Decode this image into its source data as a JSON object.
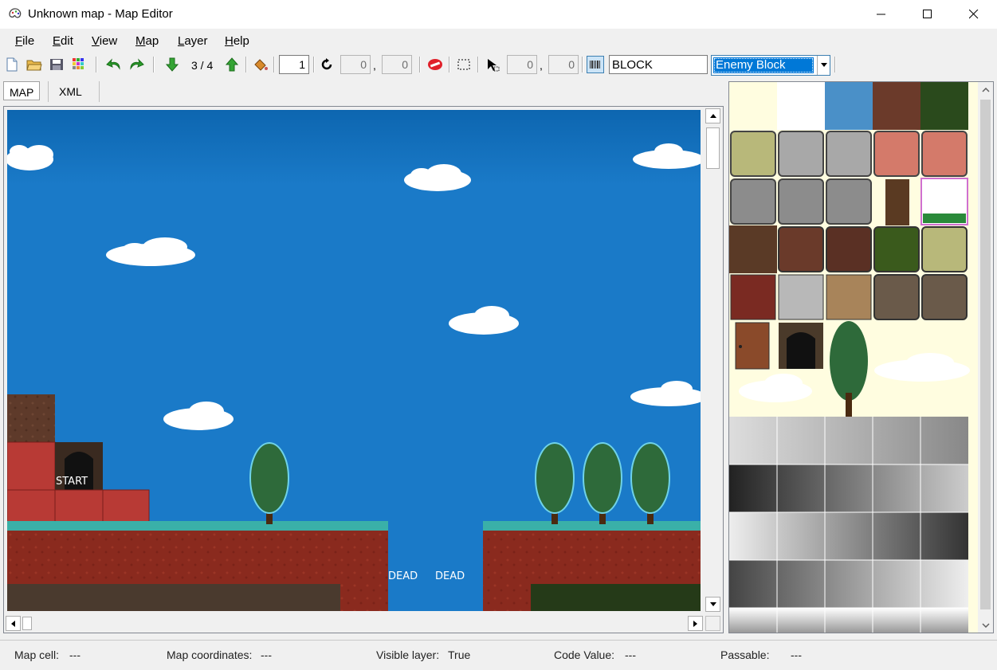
{
  "window": {
    "title": "Unknown map - Map Editor",
    "controls": {
      "minimize": "minimize-icon",
      "maximize": "maximize-icon",
      "close": "close-icon"
    }
  },
  "menu": {
    "items": [
      {
        "label": "File",
        "mnemonic": "F",
        "rest": "ile"
      },
      {
        "label": "Edit",
        "mnemonic": "E",
        "rest": "dit"
      },
      {
        "label": "View",
        "mnemonic": "V",
        "rest": "iew"
      },
      {
        "label": "Map",
        "mnemonic": "M",
        "rest": "ap"
      },
      {
        "label": "Layer",
        "mnemonic": "L",
        "rest": "ayer"
      },
      {
        "label": "Help",
        "mnemonic": "H",
        "rest": "elp"
      }
    ]
  },
  "toolbar": {
    "layer_indicator": "3 / 4",
    "tile_value": "1",
    "rotate_x": "0",
    "rotate_y": "0",
    "select_x": "0",
    "select_y": "0",
    "code_text": "BLOCK",
    "block_type_selected": "Enemy Block",
    "comma": ","
  },
  "tabs": [
    {
      "label": "MAP",
      "active": true
    },
    {
      "label": "XML",
      "active": false
    }
  ],
  "map": {
    "labels": {
      "start": "START",
      "dead_1": "DEAD",
      "dead_2": "DEAD"
    }
  },
  "status": {
    "map_cell_label": "Map cell:",
    "map_cell_value": "---",
    "map_coords_label": "Map coordinates:",
    "map_coords_value": "---",
    "visible_layer_label": "Visible layer:",
    "visible_layer_value": "True",
    "code_value_label": "Code Value:",
    "code_value_value": "---",
    "passable_label": "Passable:",
    "passable_value": "---"
  },
  "colors": {
    "sky": "#1a7ac8",
    "selection": "#0078d7",
    "grass": "#3ab0a8",
    "dirt": "#8a2a1e"
  }
}
